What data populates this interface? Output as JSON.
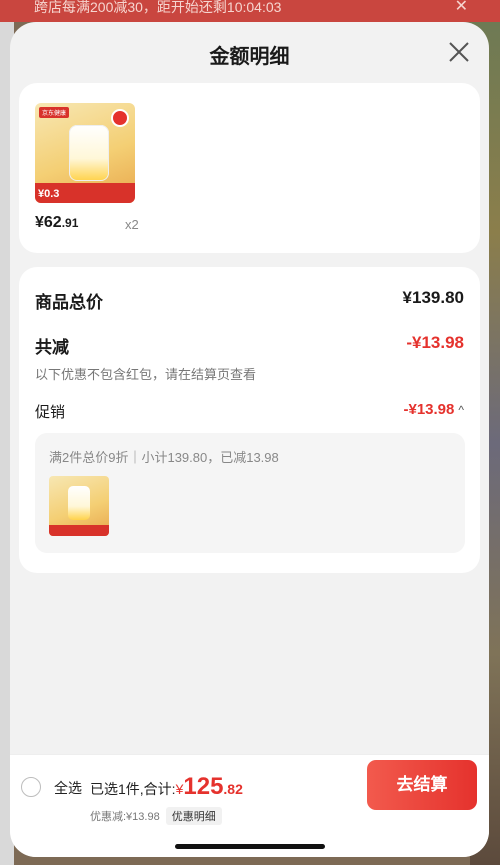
{
  "background_banner": {
    "text": "跨店每满200减30，距开始还剩10:04:03"
  },
  "header": {
    "title": "金额明细"
  },
  "product": {
    "image_badge": "京东健康",
    "image_promo": "¥0.3",
    "price_int": "¥62",
    "price_dec": ".91",
    "quantity": "x2"
  },
  "summary": {
    "total_label": "商品总价",
    "total_value": "¥139.80",
    "reduce_label": "共减",
    "reduce_value": "-¥13.98",
    "note": "以下优惠不包含红包，请在结算页查看",
    "promo_label": "促销",
    "promo_value": "-¥13.98",
    "promo_desc": "满2件总价9折｜小计139.80，已减13.98"
  },
  "footer": {
    "select_all": "全选",
    "selected_text": "已选1件,合计:",
    "currency": "¥",
    "total_int": "125",
    "total_dec": ".82",
    "discount_text": "优惠减:¥13.98",
    "detail_label": "优惠明细",
    "checkout_label": "去结算"
  },
  "colors": {
    "accent": "#e5322d",
    "sheet_bg": "#f2f2f2"
  }
}
